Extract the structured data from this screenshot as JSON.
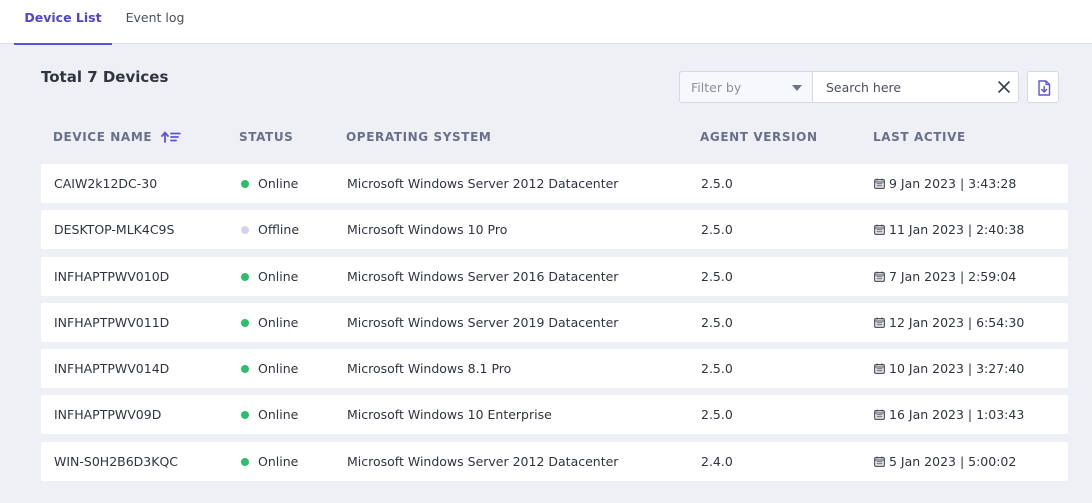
{
  "tabs": [
    {
      "label": "Device List",
      "active": true
    },
    {
      "label": "Event log",
      "active": false
    }
  ],
  "title": "Total 7 Devices",
  "filter": {
    "placeholder": "Filter by"
  },
  "search": {
    "placeholder": "Search here",
    "value": ""
  },
  "columns": {
    "name": "DEVICE NAME",
    "status": "STATUS",
    "os": "OPERATING SYSTEM",
    "agent": "AGENT VERSION",
    "last": "LAST ACTIVE"
  },
  "colors": {
    "accent": "#5b54d6",
    "online": "#2ebd6b",
    "offline": "#d4d3ef"
  },
  "devices": [
    {
      "name": "CAIW2k12DC-30",
      "status": "Online",
      "os": "Microsoft Windows Server 2012 Datacenter",
      "agent": "2.5.0",
      "last": "9 Jan 2023 | 3:43:28"
    },
    {
      "name": "DESKTOP-MLK4C9S",
      "status": "Offline",
      "os": "Microsoft Windows 10 Pro",
      "agent": "2.5.0",
      "last": "11 Jan 2023 | 2:40:38"
    },
    {
      "name": "INFHAPTPWV010D",
      "status": "Online",
      "os": "Microsoft Windows Server 2016 Datacenter",
      "agent": "2.5.0",
      "last": "7 Jan 2023 | 2:59:04"
    },
    {
      "name": "INFHAPTPWV011D",
      "status": "Online",
      "os": "Microsoft Windows Server 2019 Datacenter",
      "agent": "2.5.0",
      "last": "12 Jan 2023 | 6:54:30"
    },
    {
      "name": "INFHAPTPWV014D",
      "status": "Online",
      "os": "Microsoft Windows 8.1 Pro",
      "agent": "2.5.0",
      "last": "10 Jan 2023 | 3:27:40"
    },
    {
      "name": "INFHAPTPWV09D",
      "status": "Online",
      "os": "Microsoft Windows 10 Enterprise",
      "agent": "2.5.0",
      "last": "16 Jan 2023 | 1:03:43"
    },
    {
      "name": "WIN-S0H2B6D3KQC",
      "status": "Online",
      "os": "Microsoft Windows Server 2012 Datacenter",
      "agent": "2.4.0",
      "last": "5 Jan 2023 | 5:00:02"
    }
  ]
}
